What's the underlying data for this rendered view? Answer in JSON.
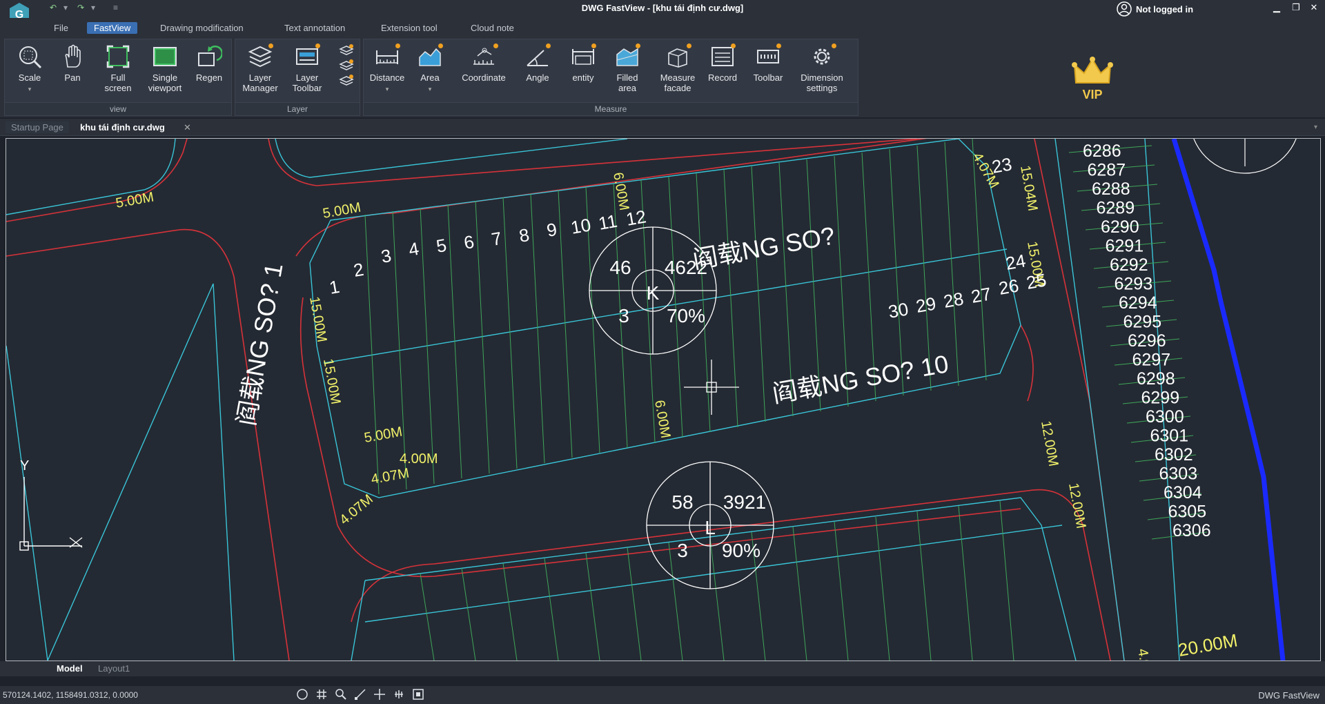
{
  "title_bar": {
    "title": "DWG FastView - [khu tái định cư.dwg]",
    "login_status": "Not logged in"
  },
  "menu": {
    "items": [
      "File",
      "FastView",
      "Drawing modification",
      "Text annotation",
      "Extension tool",
      "Cloud note"
    ],
    "active": "FastView"
  },
  "ribbon": {
    "view_group": {
      "label": "view",
      "tools": {
        "scale": "Scale",
        "pan": "Pan",
        "full_screen": "Full\nscreen",
        "single_viewport": "Single\nviewport",
        "regen": "Regen"
      }
    },
    "layer_group": {
      "label": "Layer",
      "tools": {
        "layer_manager": "Layer\nManager",
        "layer_toolbar": "Layer\nToolbar"
      }
    },
    "measure_group": {
      "label": "Measure",
      "tools": {
        "distance": "Distance",
        "area": "Area",
        "coordinate": "Coordinate",
        "angle": "Angle",
        "entity": "entity",
        "filled_area": "Filled\narea",
        "measure_facade": "Measure\nfacade",
        "record": "Record",
        "toolbar": "Toolbar",
        "dimension_settings": "Dimension\nsettings"
      }
    }
  },
  "vip_label": "VIP",
  "doc_tabs": {
    "startup": "Startup Page",
    "active": "khu tái định cư.dwg"
  },
  "drawing": {
    "road_labels": [
      "阎载NG  SO?  1",
      "阎载NG  SO?  10",
      "阎载NG  SO?"
    ],
    "dimensions": [
      "6.00M",
      "5.00M",
      "15.00M",
      "4.07M",
      "15.04M",
      "12.00M",
      "4.00M",
      "20.00M"
    ],
    "lot_numbers_right": [
      "6286",
      "6287",
      "6288",
      "6289",
      "6290",
      "6291",
      "6292",
      "6293",
      "6294",
      "6295",
      "6296",
      "6297",
      "6298",
      "6299",
      "6300",
      "6301",
      "6302",
      "6303",
      "6304",
      "6305",
      "6306"
    ],
    "block_k": {
      "letter": "K",
      "top_left": "46",
      "top_right": "4622",
      "bottom_left": "3",
      "bottom_right": "70%"
    },
    "block_l": {
      "letter": "L",
      "top_left": "58",
      "top_right": "3921",
      "bottom_left": "3",
      "bottom_right": "90%"
    },
    "axis_y": "Y"
  },
  "layout_tabs": {
    "model": "Model",
    "layout1": "Layout1"
  },
  "status": {
    "coordinates": "570124.1402, 1158491.0312, 0.0000",
    "app_name": "DWG FastView"
  }
}
